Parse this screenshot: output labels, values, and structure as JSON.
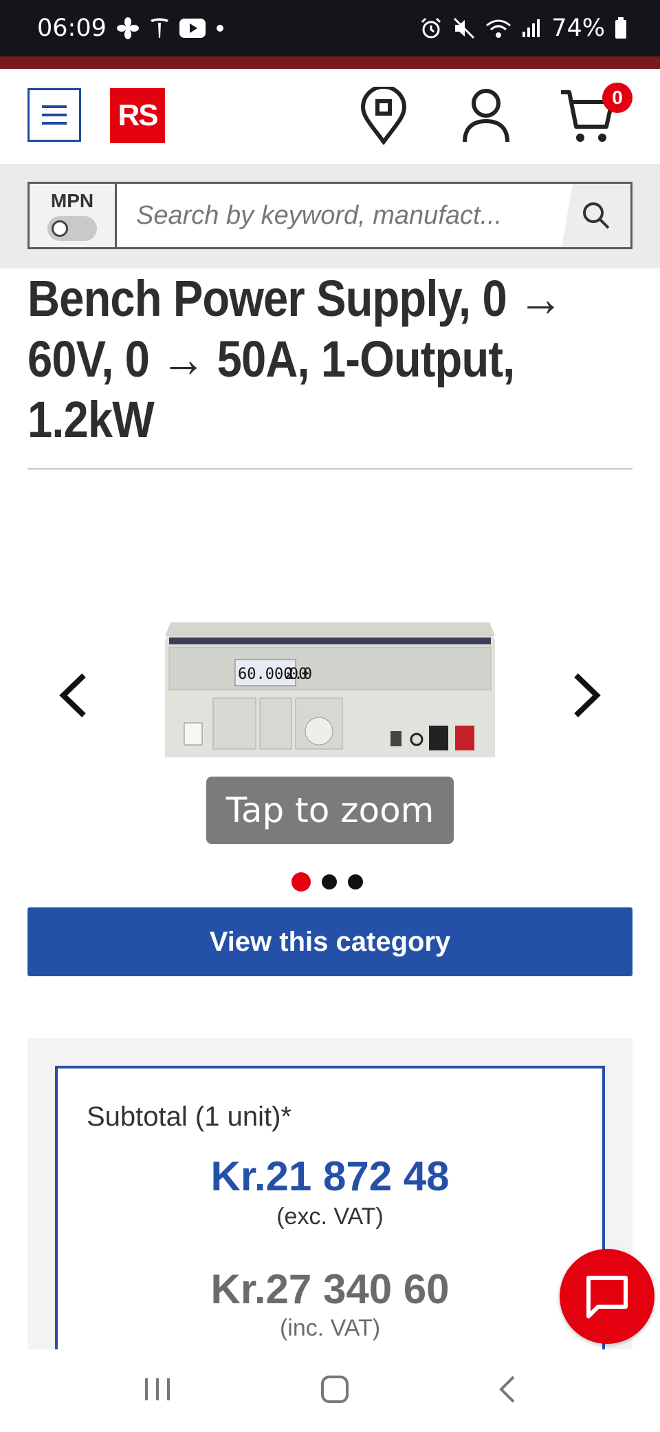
{
  "status_bar": {
    "time": "06:09",
    "battery": "74%"
  },
  "header": {
    "logo_text": "RS",
    "cart_count": "0"
  },
  "search": {
    "mpn_label": "MPN",
    "placeholder": "Search by keyword, manufact..."
  },
  "product": {
    "title_lines": [
      "Bench Power Supply, 0 →",
      "60V, 0 → 50A, 1-Output,",
      "1.2kW"
    ],
    "display_voltage": "60.000",
    "display_current": "20.00",
    "zoom_label": "Tap to zoom",
    "image_count": 3,
    "active_image": 1
  },
  "category_button": "View this category",
  "pricing": {
    "subtotal_label": "Subtotal (1 unit)*",
    "price_ex_vat": "Kr.21 872 48",
    "ex_vat_note": "(exc. VAT)",
    "price_inc_vat": "Kr.27 340 60",
    "inc_vat_note": "(inc. VAT)"
  },
  "colors": {
    "brand_red": "#e3000f",
    "brand_blue": "#2450a8",
    "status_bar": "#13151a"
  },
  "icons": [
    "menu-icon",
    "location-pin-icon",
    "account-icon",
    "cart-icon",
    "search-icon",
    "chevron-left-icon",
    "chevron-right-icon",
    "chat-icon"
  ]
}
